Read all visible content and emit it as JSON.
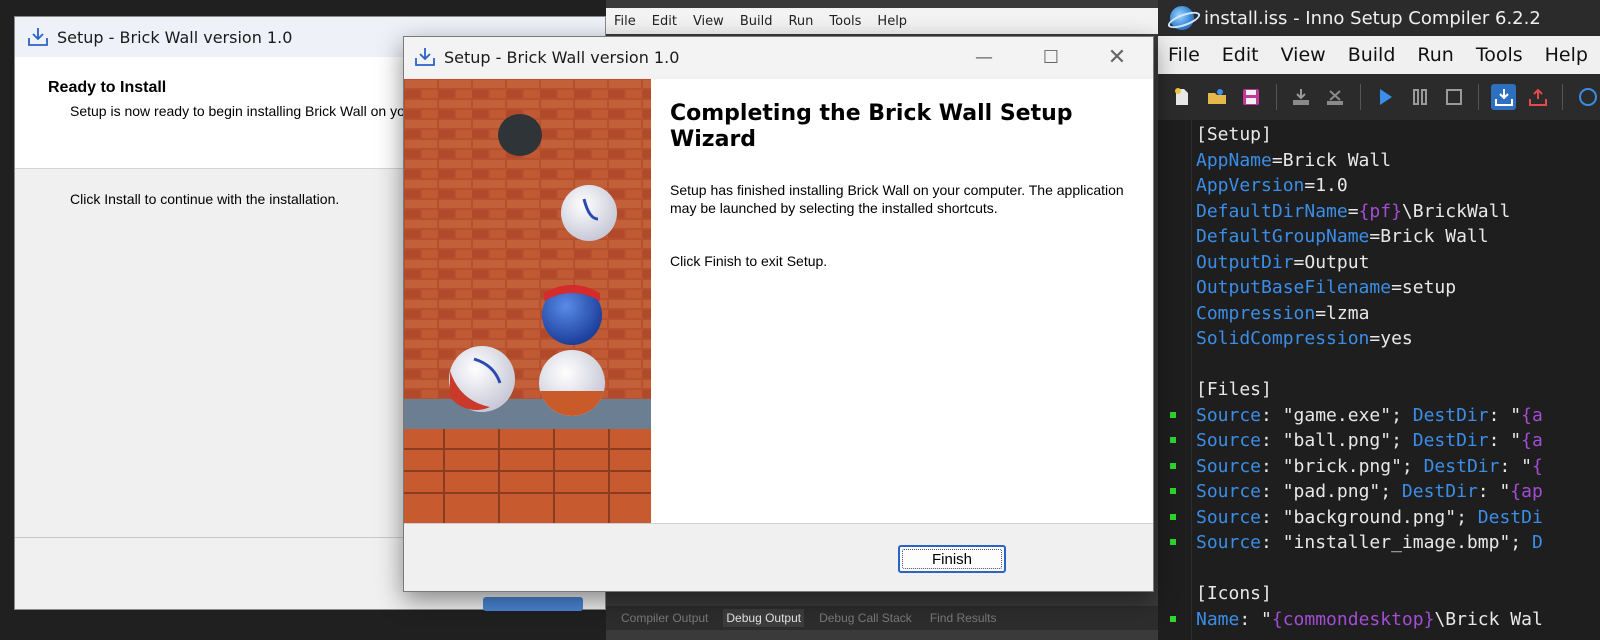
{
  "mid_ide": {
    "menu": [
      "File",
      "Edit",
      "View",
      "Build",
      "Run",
      "Tools",
      "Help"
    ],
    "bottom_tabs": [
      "Compiler Output",
      "Debug Output",
      "Debug Call Stack",
      "Find Results"
    ],
    "active_tab": "Debug Output"
  },
  "back_dialog": {
    "title": "Setup - Brick Wall version 1.0",
    "heading": "Ready to Install",
    "subheading": "Setup is now ready to begin installing Brick Wall on your computer.",
    "body": "Click Install to continue with the installation."
  },
  "dialog": {
    "title": "Setup - Brick Wall version 1.0",
    "heading": "Completing the Brick Wall Setup Wizard",
    "paragraph1": "Setup has finished installing Brick Wall on your computer. The application may be launched by selecting the installed shortcuts.",
    "paragraph2": "Click Finish to exit Setup.",
    "finish_label": "Finish",
    "window_controls": [
      "minimize-icon",
      "maximize-icon",
      "close-icon"
    ]
  },
  "iss": {
    "title": "install.iss - Inno Setup Compiler 6.2.2",
    "menu": [
      "File",
      "Edit",
      "View",
      "Build",
      "Run",
      "Tools",
      "Help"
    ],
    "toolbar": [
      "new-file-icon",
      "open-file-icon",
      "save-icon",
      "compile-icon",
      "stop-compile-icon",
      "run-icon",
      "pause-icon",
      "stop-icon",
      "target-setup-icon",
      "target-uninstall-icon",
      "help-icon"
    ],
    "code": [
      {
        "parts": [
          {
            "t": "[Setup]",
            "c": "v"
          }
        ]
      },
      {
        "parts": [
          {
            "t": "AppName",
            "c": "k"
          },
          {
            "t": "=Brick Wall",
            "c": "v"
          }
        ]
      },
      {
        "parts": [
          {
            "t": "AppVersion",
            "c": "k"
          },
          {
            "t": "=1.0",
            "c": "v"
          }
        ]
      },
      {
        "parts": [
          {
            "t": "DefaultDirName",
            "c": "k"
          },
          {
            "t": "=",
            "c": "v"
          },
          {
            "t": "{pf}",
            "c": "c"
          },
          {
            "t": "\\BrickWall",
            "c": "v"
          }
        ]
      },
      {
        "parts": [
          {
            "t": "DefaultGroupName",
            "c": "k"
          },
          {
            "t": "=Brick Wall",
            "c": "v"
          }
        ]
      },
      {
        "parts": [
          {
            "t": "OutputDir",
            "c": "k"
          },
          {
            "t": "=Output",
            "c": "v"
          }
        ]
      },
      {
        "parts": [
          {
            "t": "OutputBaseFilename",
            "c": "k"
          },
          {
            "t": "=setup",
            "c": "v"
          }
        ]
      },
      {
        "parts": [
          {
            "t": "Compression",
            "c": "k"
          },
          {
            "t": "=lzma",
            "c": "v"
          }
        ]
      },
      {
        "parts": [
          {
            "t": "SolidCompression",
            "c": "k"
          },
          {
            "t": "=yes",
            "c": "v"
          }
        ]
      },
      {
        "parts": [
          {
            "t": "",
            "c": "v"
          }
        ]
      },
      {
        "parts": [
          {
            "t": "[Files]",
            "c": "v"
          }
        ]
      },
      {
        "dot": true,
        "parts": [
          {
            "t": "Source",
            "c": "k"
          },
          {
            "t": ": \"game.exe\"; ",
            "c": "v"
          },
          {
            "t": "DestDir",
            "c": "k"
          },
          {
            "t": ": \"",
            "c": "v"
          },
          {
            "t": "{a",
            "c": "c"
          }
        ]
      },
      {
        "dot": true,
        "parts": [
          {
            "t": "Source",
            "c": "k"
          },
          {
            "t": ": \"ball.png\"; ",
            "c": "v"
          },
          {
            "t": "DestDir",
            "c": "k"
          },
          {
            "t": ": \"",
            "c": "v"
          },
          {
            "t": "{a",
            "c": "c"
          }
        ]
      },
      {
        "dot": true,
        "parts": [
          {
            "t": "Source",
            "c": "k"
          },
          {
            "t": ": \"brick.png\"; ",
            "c": "v"
          },
          {
            "t": "DestDir",
            "c": "k"
          },
          {
            "t": ": \"",
            "c": "v"
          },
          {
            "t": "{",
            "c": "c"
          }
        ]
      },
      {
        "dot": true,
        "parts": [
          {
            "t": "Source",
            "c": "k"
          },
          {
            "t": ": \"pad.png\"; ",
            "c": "v"
          },
          {
            "t": "DestDir",
            "c": "k"
          },
          {
            "t": ": \"",
            "c": "v"
          },
          {
            "t": "{ap",
            "c": "c"
          }
        ]
      },
      {
        "dot": true,
        "parts": [
          {
            "t": "Source",
            "c": "k"
          },
          {
            "t": ": \"background.png\"; ",
            "c": "v"
          },
          {
            "t": "DestDi",
            "c": "k"
          }
        ]
      },
      {
        "dot": true,
        "parts": [
          {
            "t": "Source",
            "c": "k"
          },
          {
            "t": ": \"installer_image.bmp\"; ",
            "c": "v"
          },
          {
            "t": "D",
            "c": "k"
          }
        ]
      },
      {
        "parts": [
          {
            "t": "",
            "c": "v"
          }
        ]
      },
      {
        "parts": [
          {
            "t": "[Icons]",
            "c": "v"
          }
        ]
      },
      {
        "dot": true,
        "parts": [
          {
            "t": "Name",
            "c": "k"
          },
          {
            "t": ": \"",
            "c": "v"
          },
          {
            "t": "{commondesktop}",
            "c": "c"
          },
          {
            "t": "\\Brick Wal",
            "c": "v"
          }
        ]
      }
    ]
  }
}
